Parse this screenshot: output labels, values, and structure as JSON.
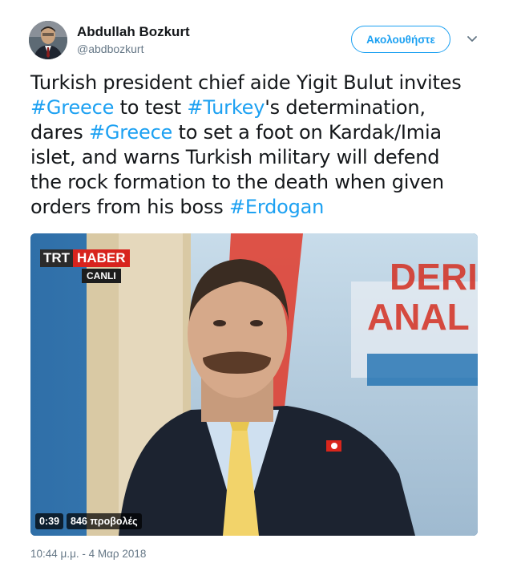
{
  "author": {
    "name": "Abdullah Bozkurt",
    "handle": "@abdbozkurt",
    "avatar_icon": "profile-photo"
  },
  "header": {
    "follow_label": "Ακολουθήστε",
    "more_icon": "chevron-down-icon"
  },
  "tweet": {
    "lines": [
      [
        {
          "text": "Turkish president chief aide Yigit Bulut invites",
          "hashtag": false
        }
      ],
      [
        {
          "text": "#Greece",
          "hashtag": true
        },
        {
          "text": " to test ",
          "hashtag": false
        },
        {
          "text": "#Turkey",
          "hashtag": true
        },
        {
          "text": "'s determination,",
          "hashtag": false
        }
      ],
      [
        {
          "text": "dares ",
          "hashtag": false
        },
        {
          "text": "#Greece",
          "hashtag": true
        },
        {
          "text": " to set a foot on Kardak/Imia",
          "hashtag": false
        }
      ],
      [
        {
          "text": "islet, and warns Turkish military will defend",
          "hashtag": false
        }
      ],
      [
        {
          "text": "the rock formation to the death when given",
          "hashtag": false
        }
      ],
      [
        {
          "text": "orders from his boss ",
          "hashtag": false
        },
        {
          "text": "#Erdogan",
          "hashtag": true
        }
      ]
    ]
  },
  "video": {
    "channel_trt": "TRT",
    "channel_haber": "HABER",
    "channel_live": "CANLI",
    "background_text": "DERIN ANAL",
    "duration": "0:39",
    "views": "846 προβολές"
  },
  "timestamp": "10:44 μ.μ. - 4 Μαρ 2018",
  "colors": {
    "accent": "#1da1f2",
    "text": "#14171a",
    "muted": "#657786"
  }
}
